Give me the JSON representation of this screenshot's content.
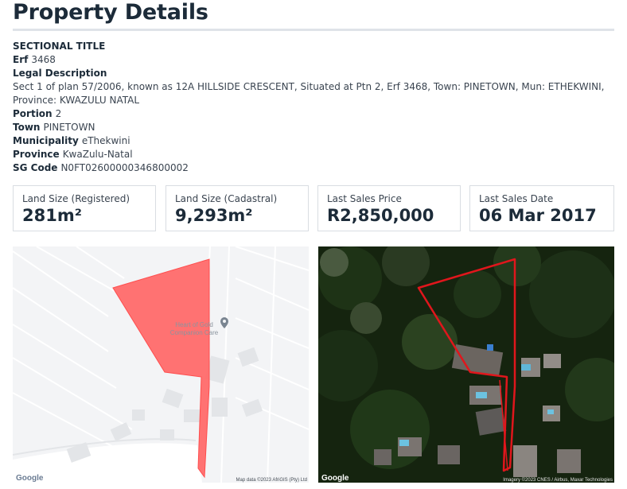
{
  "page": {
    "title": "Property Details"
  },
  "details": {
    "type_label": "SECTIONAL TITLE",
    "erf": {
      "label": "Erf",
      "value": "3468"
    },
    "legal": {
      "label": "Legal Description",
      "value": "Sect 1 of plan 57/2006, known as 12A HILLSIDE CRESCENT, Situated at Ptn 2, Erf 3468, Town: PINETOWN, Mun: ETHEKWINI, Province: KWAZULU NATAL"
    },
    "portion": {
      "label": "Portion",
      "value": "2"
    },
    "town": {
      "label": "Town",
      "value": "PINETOWN"
    },
    "municipality": {
      "label": "Municipality",
      "value": "eThekwini"
    },
    "province": {
      "label": "Province",
      "value": "KwaZulu-Natal"
    },
    "sg_code": {
      "label": "SG Code",
      "value": "N0FT02600000346800002"
    }
  },
  "cards": [
    {
      "label": "Land Size (Registered)",
      "value": "281m²"
    },
    {
      "label": "Land Size (Cadastral)",
      "value": "9,293m²"
    },
    {
      "label": "Last Sales Price",
      "value": "R2,850,000"
    },
    {
      "label": "Last Sales Date",
      "value": "06 Mar 2017"
    }
  ],
  "maps": {
    "street": {
      "poi_label_line1": "Heart of Gold",
      "poi_label_line2": "Companion Care",
      "logo": "Google",
      "attribution": "Map data ©2023 AfriGIS (Pty) Ltd",
      "parcel_color": "#ff6a6a"
    },
    "satellite": {
      "logo": "Google",
      "attribution": "Imagery ©2023 CNES / Airbus, Maxar Technologies",
      "outline_color": "#e0161c"
    }
  }
}
